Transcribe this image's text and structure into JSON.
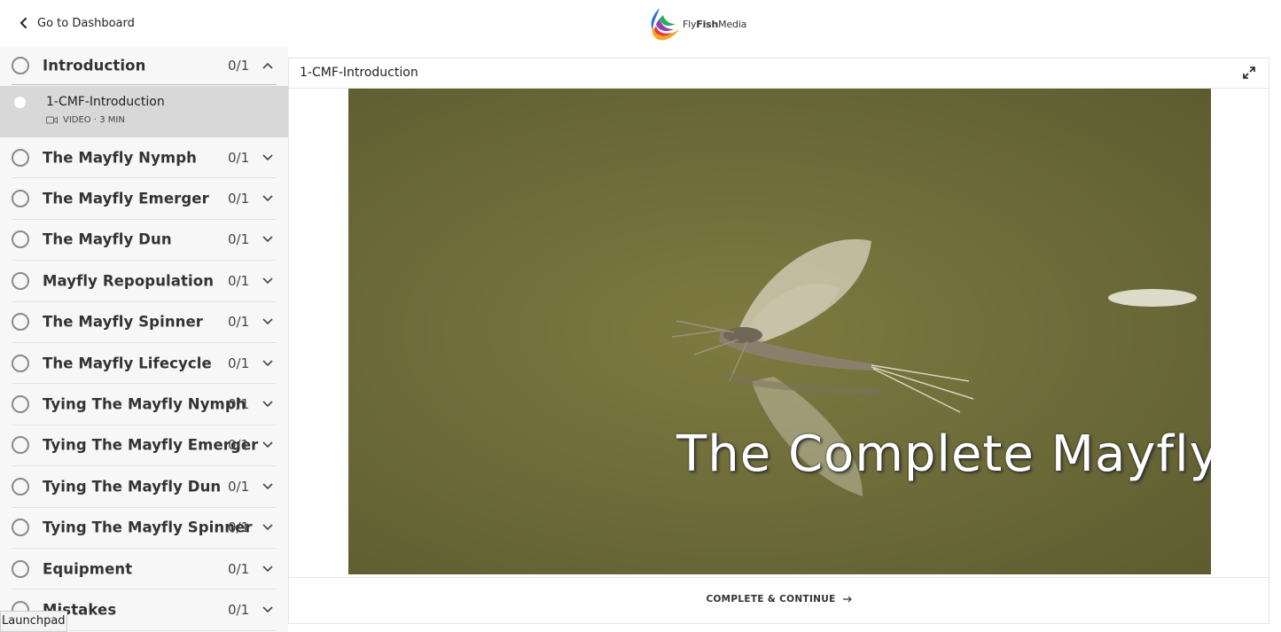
{
  "header": {
    "back_label": "Go to Dashboard",
    "logo_text_fly": "Fly",
    "logo_text_fish": "Fish",
    "logo_text_media": "Media"
  },
  "sidebar": {
    "sections": [
      {
        "title": "Introduction",
        "count": "0/1",
        "expanded": true
      },
      {
        "title": "The Mayfly Nymph",
        "count": "0/1",
        "expanded": false
      },
      {
        "title": "The Mayfly Emerger",
        "count": "0/1",
        "expanded": false
      },
      {
        "title": "The Mayfly Dun",
        "count": "0/1",
        "expanded": false
      },
      {
        "title": "Mayfly Repopulation",
        "count": "0/1",
        "expanded": false
      },
      {
        "title": "The Mayfly Spinner",
        "count": "0/1",
        "expanded": false
      },
      {
        "title": "The Mayfly Lifecycle",
        "count": "0/1",
        "expanded": false
      },
      {
        "title": "Tying The Mayfly Nymph",
        "count": "0/1",
        "expanded": false
      },
      {
        "title": "Tying The Mayfly Emerger",
        "count": "0/1",
        "expanded": false
      },
      {
        "title": "Tying The Mayfly Dun",
        "count": "0/1",
        "expanded": false
      },
      {
        "title": "Tying The Mayfly Spinner",
        "count": "0/1",
        "expanded": false
      },
      {
        "title": "Equipment",
        "count": "0/1",
        "expanded": false
      },
      {
        "title": "Mistakes",
        "count": "0/1",
        "expanded": false
      }
    ],
    "active_lesson": {
      "title": "1-CMF-Introduction",
      "meta": "VIDEO · 3 MIN",
      "icon": "video-camera-icon"
    }
  },
  "main": {
    "title": "1-CMF-Introduction",
    "video_caption": "The Complete Mayfly",
    "complete_label": "COMPLETE & CONTINUE"
  },
  "launchpad_label": "Launchpad",
  "colors": {
    "sidebar_bg": "#f7f7f7",
    "active_lesson_bg": "#d8d8d8",
    "video_water": "#6f6d3a"
  }
}
